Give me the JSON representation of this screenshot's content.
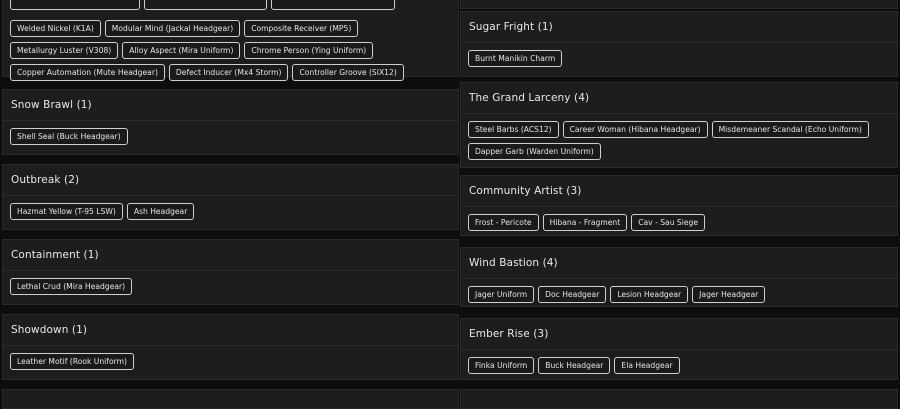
{
  "left_top_tags": [
    "Welded Nickel (K1A)",
    "Modular Mind (Jackal Headgear)",
    "Composite Receiver (MP5)",
    "Metallurgy Luster (V308)",
    "Alloy Aspect (Mira Uniform)",
    "Chrome Person (Ying Uniform)",
    "Copper Automation (Mute Headgear)",
    "Defect Inducer (Mx4 Storm)",
    "Controller Groove (SIX12)"
  ],
  "left_sections": [
    {
      "title": "Snow Brawl (1)",
      "tags": [
        "Shell Seal (Buck Headgear)"
      ]
    },
    {
      "title": "Outbreak (2)",
      "tags": [
        "Hazmat Yellow (T-95 LSW)",
        "Ash Headgear"
      ]
    },
    {
      "title": "Containment (1)",
      "tags": [
        "Lethal Crud (Mira Headgear)"
      ]
    },
    {
      "title": "Showdown (1)",
      "tags": [
        "Leather Motif (Rook Uniform)"
      ]
    }
  ],
  "right_sections": [
    {
      "title": "Sugar Fright (1)",
      "tags": [
        "Burnt Manikin Charm"
      ]
    },
    {
      "title": "The Grand Larceny (4)",
      "tags": [
        "Steel Barbs (ACS12)",
        "Career Woman (Hibana Headgear)",
        "Misdemeaner Scandal (Echo Uniform)",
        "Dapper Garb (Warden Uniform)"
      ]
    },
    {
      "title": "Community Artist (3)",
      "tags": [
        "Frost - Pericote",
        "Hibana - Fragment",
        "Cav - Sau Siege"
      ]
    },
    {
      "title": "Wind Bastion (4)",
      "tags": [
        "Jager Uniform",
        "Doc Headgear",
        "Lesion Headgear",
        "Jager Headgear"
      ]
    },
    {
      "title": "Ember Rise (3)",
      "tags": [
        "Finka Uniform",
        "Buck Headgear",
        "Ela Headgear"
      ]
    }
  ]
}
